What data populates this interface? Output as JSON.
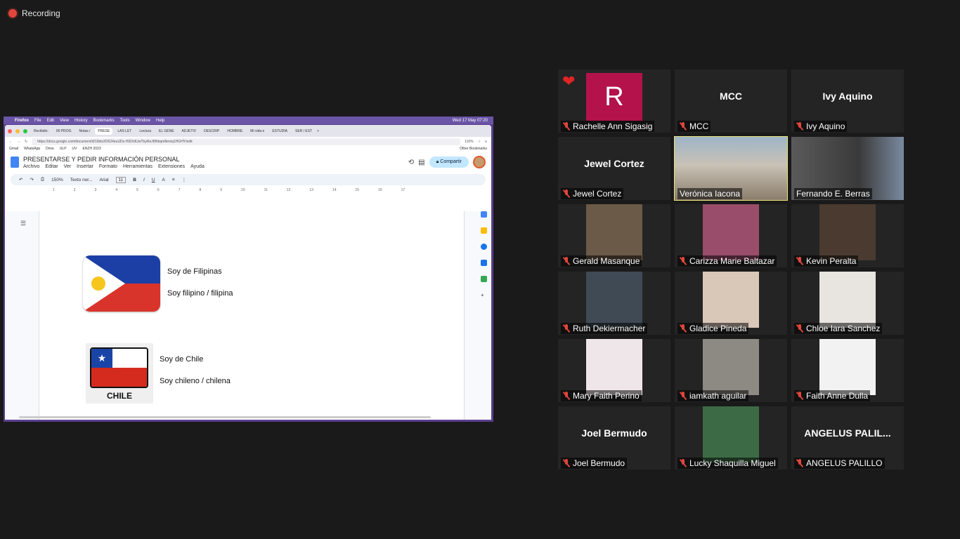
{
  "recording": {
    "label": "Recording"
  },
  "mac_menubar": {
    "items": [
      "Firefox",
      "File",
      "Edit",
      "View",
      "History",
      "Bookmarks",
      "Tools",
      "Window",
      "Help"
    ],
    "datetime": "Wed 17 May 07:20"
  },
  "browser": {
    "tabs": [
      "Recibido:",
      "00 PROG",
      "Notas / ",
      "PRESE",
      "LAS LET",
      "Lectura",
      "EL GÉNE",
      "ADJETIV",
      "DESCRIP",
      "HOMBRE",
      "Mi vida e",
      "ESTUDIA",
      "SER / EST"
    ],
    "url": "https://docs.google.com/document/d/16kts3O624euUDs-HiDXdUwTbyReJ6fhbqm8emq1HGHY/edit",
    "zoom": "110%",
    "bookmarks": [
      "Gmail",
      "WhatsApp",
      "Drive",
      "ULP",
      "UV",
      "ENZH 2023"
    ],
    "other_bookmarks": "Other Bookmarks"
  },
  "doc": {
    "title": "PRESENTARSE Y PEDIR INFORMACIÓN PERSONAL",
    "menu": [
      "Archivo",
      "Editar",
      "Ver",
      "Insertar",
      "Formato",
      "Herramientas",
      "Extensiones",
      "Ayuda"
    ],
    "share_label": "Compartir",
    "toolbar": {
      "zoom": "150%",
      "style": "Texto nor...",
      "font": "Arial",
      "size": "11"
    },
    "ruler": [
      "1",
      "2",
      "3",
      "4",
      "5",
      "6",
      "7",
      "8",
      "9",
      "10",
      "11",
      "12",
      "13",
      "14",
      "15",
      "16",
      "17"
    ],
    "lines": {
      "ph_country": "Soy de Filipinas",
      "ph_nationality": "Soy filipino / filipina",
      "cl_country": "Soy de Chile",
      "cl_nationality": "Soy chileno / chilena"
    },
    "chile_flag_label": "CHILE"
  },
  "participants": [
    {
      "name": "Rachelle Ann Sigasig",
      "display": "avatar",
      "avatar_letter": "R",
      "reaction": "heart",
      "muted": true
    },
    {
      "name": "MCC",
      "display": "name",
      "muted": true
    },
    {
      "name": "Ivy Aquino",
      "display": "name",
      "muted": true
    },
    {
      "name": "Jewel Cortez",
      "display": "name",
      "muted": true
    },
    {
      "name": "Verónica Iacona",
      "display": "video",
      "active_speaker": true,
      "muted": false
    },
    {
      "name": "Fernando E. Berras",
      "display": "video",
      "muted": false
    },
    {
      "name": "Gerald Masanque",
      "display": "photo",
      "muted": true
    },
    {
      "name": "Carizza Marie Baltazar",
      "display": "photo",
      "muted": true
    },
    {
      "name": "Kevin Peralta",
      "display": "photo",
      "muted": true
    },
    {
      "name": "Ruth Dekiermacher",
      "display": "photo",
      "muted": true
    },
    {
      "name": "Gladice Pineda",
      "display": "photo",
      "muted": true
    },
    {
      "name": "Chloe Iara Sanchez",
      "display": "photo",
      "muted": true
    },
    {
      "name": "Mary Faith Perino",
      "display": "photo",
      "muted": true
    },
    {
      "name": "iamkath aguilar",
      "display": "photo",
      "muted": true
    },
    {
      "name": "Faith Anne Dulla",
      "display": "photo",
      "muted": true
    },
    {
      "name": "Joel Bermudo",
      "display": "name",
      "muted": true
    },
    {
      "name": "Lucky Shaquilla Miguel",
      "display": "photo",
      "muted": true
    },
    {
      "name": "ANGELUS PALILLO",
      "display": "name",
      "big_label": "ANGELUS PALIL...",
      "muted": true
    }
  ],
  "colors": {
    "background": "#1a1a1a",
    "tile": "#242424",
    "active_speaker": "#e9e37a",
    "muted": "#e0463c",
    "share_btn": "#c2e7ff"
  }
}
